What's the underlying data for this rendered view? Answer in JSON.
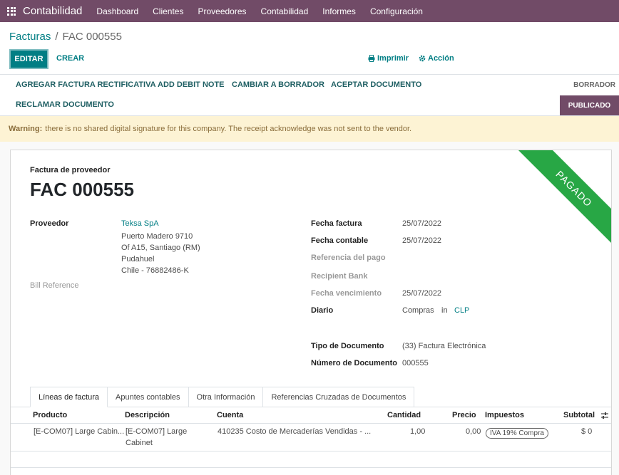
{
  "navbar": {
    "brand": "Contabilidad",
    "menu": [
      "Dashboard",
      "Clientes",
      "Proveedores",
      "Contabilidad",
      "Informes",
      "Configuración"
    ]
  },
  "breadcrumb": {
    "parent": "Facturas",
    "separator": "/",
    "current": "FAC 000555"
  },
  "toolbar": {
    "edit_label": "EDITAR",
    "create_label": "CREAR",
    "print_label": "Imprimir",
    "action_label": "Acción"
  },
  "statusbar": {
    "buttons": [
      "AGREGAR FACTURA RECTIFICATIVA",
      "ADD DEBIT NOTE",
      "CAMBIAR A BORRADOR",
      "ACEPTAR DOCUMENTO",
      "RECLAMAR DOCUMENTO"
    ],
    "stage_draft": "BORRADOR",
    "stage_posted": "PUBLICADO"
  },
  "alert": {
    "title": "Warning:",
    "text": "there is no shared digital signature for this company. The receipt acknowledge was not sent to the vendor."
  },
  "form": {
    "ribbon": "PAGADO",
    "doc_type": "Factura de proveedor",
    "doc_number": "FAC 000555",
    "vendor_label": "Proveedor",
    "vendor_name": "Teksa SpA",
    "vendor_address": [
      "Puerto Madero 9710",
      "Of A15, Santiago (RM)",
      "Pudahuel",
      "Chile - 76882486-K"
    ],
    "bill_ref_label": "Bill Reference",
    "invoice_date_label": "Fecha factura",
    "invoice_date": "25/07/2022",
    "accounting_date_label": "Fecha contable",
    "accounting_date": "25/07/2022",
    "payment_ref_label": "Referencia del pago",
    "recipient_bank_label": "Recipient Bank",
    "due_date_label": "Fecha vencimiento",
    "due_date": "25/07/2022",
    "journal_label": "Diario",
    "journal": "Compras",
    "journal_in": "in",
    "currency": "CLP",
    "doc_kind_label": "Tipo de Documento",
    "doc_kind": "(33) Factura Electrónica",
    "doc_num_label": "Número de Documento",
    "doc_num": "000555"
  },
  "tabs": [
    "Líneas de factura",
    "Apuntes contables",
    "Otra Información",
    "Referencias Cruzadas de Documentos"
  ],
  "table": {
    "headers": {
      "product": "Producto",
      "description": "Descripción",
      "account": "Cuenta",
      "quantity": "Cantidad",
      "price": "Precio",
      "taxes": "Impuestos",
      "subtotal": "Subtotal"
    },
    "rows": [
      {
        "product": "[E-COM07] Large Cabin...",
        "description_1": "[E-COM07] Large",
        "description_2": "Cabinet",
        "account": "410235 Costo de Mercaderías Vendidas - ...",
        "quantity": "1,00",
        "price": "0,00",
        "tax": "IVA 19% Compra",
        "subtotal": "$ 0"
      }
    ]
  },
  "colors": {
    "brand": "#714b67",
    "accent": "#017e84",
    "ribbon": "#28a745",
    "warning_bg": "#fdf3d4"
  }
}
